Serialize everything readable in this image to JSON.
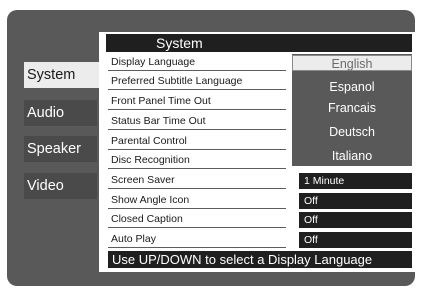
{
  "sidebar": {
    "items": [
      {
        "label": "System",
        "active": true
      },
      {
        "label": "Audio",
        "active": false
      },
      {
        "label": "Speaker",
        "active": false
      },
      {
        "label": "Video",
        "active": false
      }
    ]
  },
  "panel": {
    "title": "System",
    "settings": [
      {
        "label": "Display Language"
      },
      {
        "label": "Preferred Subtitle Language"
      },
      {
        "label": "Front Panel Time Out"
      },
      {
        "label": "Status Bar Time Out"
      },
      {
        "label": "Parental Control"
      },
      {
        "label": "Disc Recognition"
      },
      {
        "label": "Screen Saver",
        "value": "1 Minute"
      },
      {
        "label": "Show Angle Icon",
        "value": "Off"
      },
      {
        "label": "Closed Caption",
        "value": "Off"
      },
      {
        "label": "Auto Play",
        "value": "Off"
      }
    ],
    "language_options": [
      "English",
      "Espanol",
      "Francais",
      "Deutsch",
      "Italiano"
    ],
    "selected_language": "English"
  },
  "status_bar": {
    "text": "Use UP/DOWN to select a Display Language"
  },
  "colors": {
    "screen_background": "#595959",
    "sidebar_item": "#4a4a4a",
    "active_item": "#ececec",
    "dark_bar": "#1f1f1f",
    "panel": "#ffffff"
  }
}
